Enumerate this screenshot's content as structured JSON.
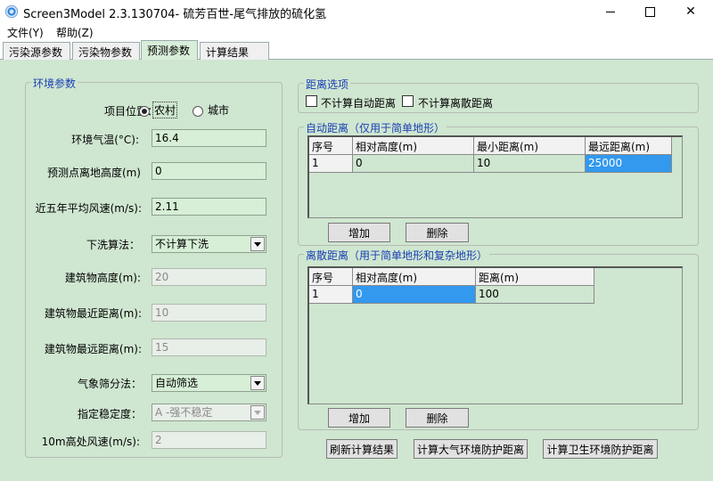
{
  "window": {
    "title": "Screen3Model 2.3.130704- 硫芳百世-尾气排放的硫化氢"
  },
  "menu": {
    "file": "文件(Y)",
    "help": "帮助(Z)"
  },
  "tabs": [
    "污染源参数",
    "污染物参数",
    "预测参数",
    "计算结果"
  ],
  "env": {
    "title": "环境参数",
    "location_label": "项目位置：",
    "location_options": [
      "农村",
      "城市"
    ],
    "location_selected": "农村",
    "temp_label": "环境气温(°C):",
    "temp_value": "16.4",
    "height_label": "预测点离地高度(m)",
    "height_value": "0",
    "wind5_label": "近五年平均风速(m/s):",
    "wind5_value": "2.11",
    "downwash_label": "下洗算法：",
    "downwash_value": "不计算下洗",
    "bldg_height_label": "建筑物高度(m):",
    "bldg_height_value": "20",
    "bldg_near_label": "建筑物最近距离(m):",
    "bldg_near_value": "10",
    "bldg_far_label": "建筑物最远距离(m):",
    "bldg_far_value": "15",
    "met_label": "气象筛分法：",
    "met_value": "自动筛选",
    "stability_label": "指定稳定度：",
    "stability_value": "A -强不稳定",
    "wind10_label": "10m高处风速(m/s):",
    "wind10_value": "2"
  },
  "distopts": {
    "title": "距离选项",
    "no_auto": "不计算自动距离",
    "no_discrete": "不计算离散距离"
  },
  "auto": {
    "title": "自动距离（仅用于简单地形）",
    "headers": [
      "序号",
      "相对高度(m)",
      "最小距离(m)",
      "最远距离(m)"
    ],
    "rows": [
      [
        "1",
        "0",
        "10",
        "25000"
      ]
    ],
    "add": "增加",
    "delete": "删除"
  },
  "discrete": {
    "title": "离散距离（用于简单地形和复杂地形）",
    "headers": [
      "序号",
      "相对高度(m)",
      "距离(m)"
    ],
    "rows": [
      [
        "1",
        "0",
        "100"
      ]
    ],
    "add": "增加",
    "delete": "删除"
  },
  "actions": {
    "refresh": "刷新计算结果",
    "air_dist": "计算大气环境防护距离",
    "health_dist": "计算卫生环境防护距离"
  }
}
